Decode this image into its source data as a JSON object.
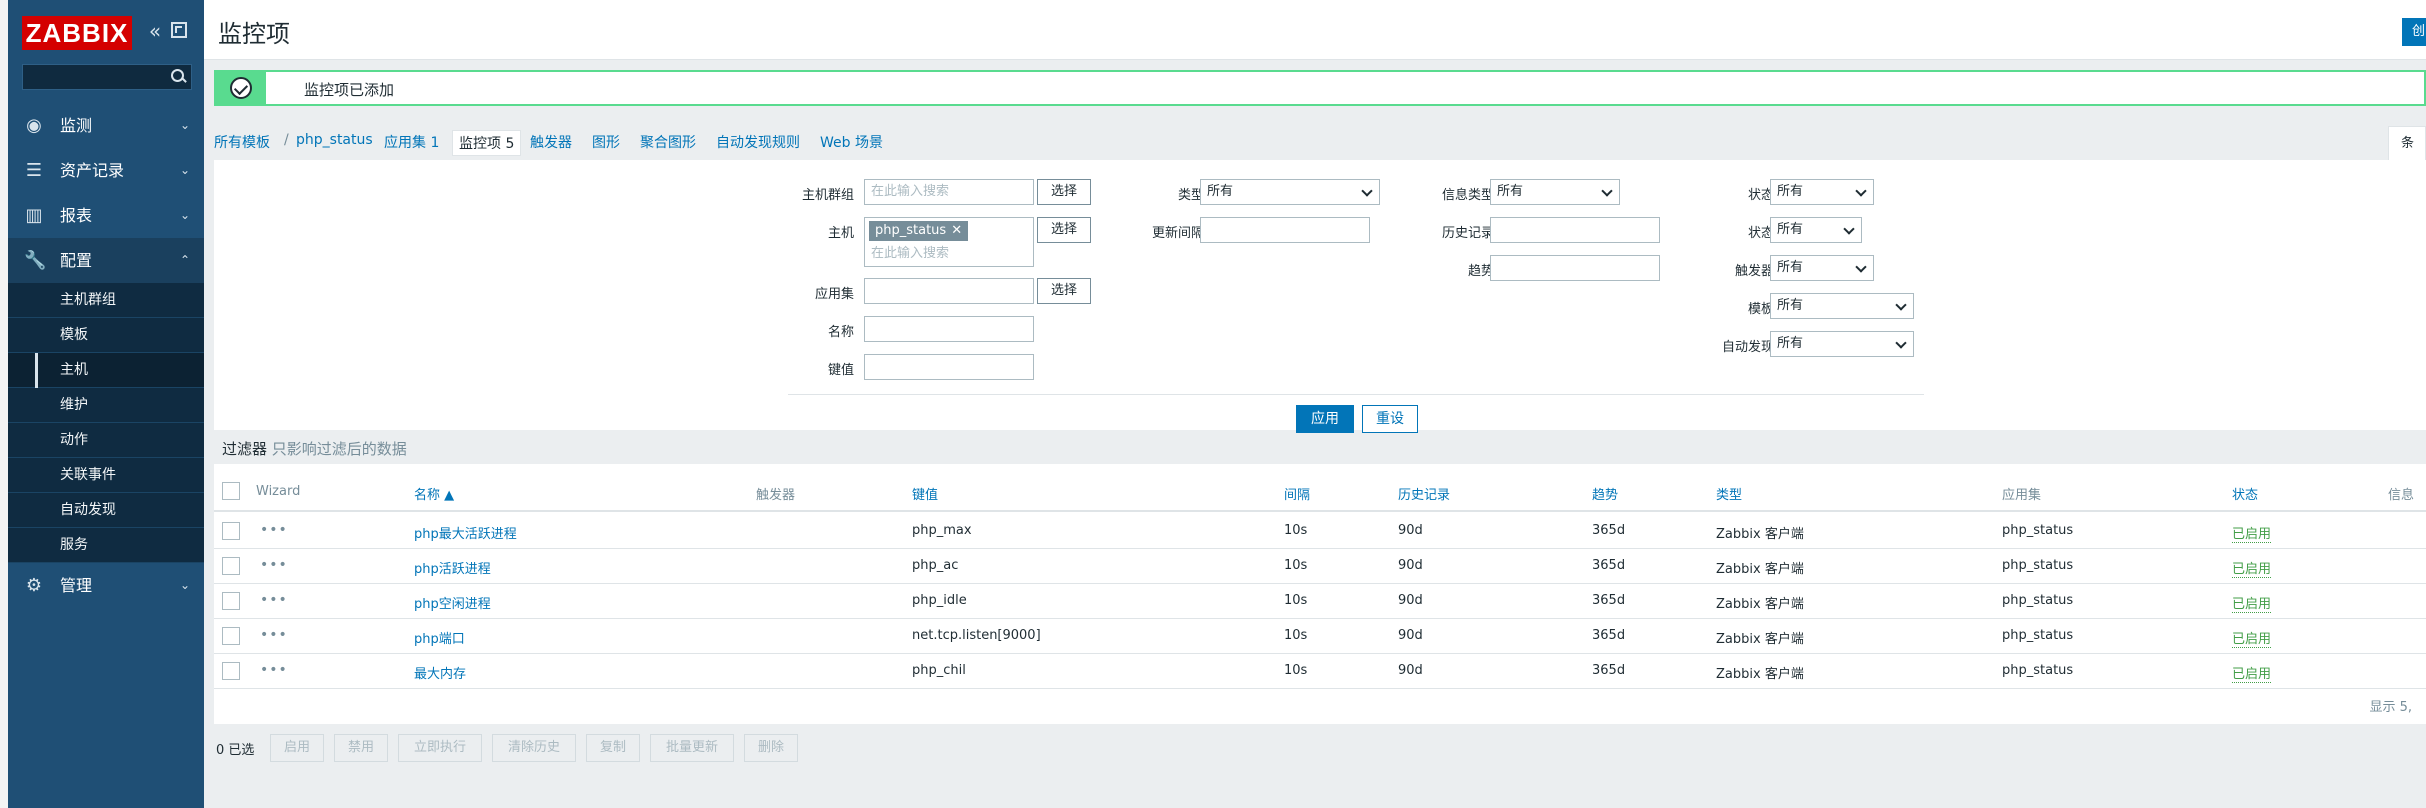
{
  "sidebar": {
    "logo": "ZABBIX",
    "menu": [
      {
        "label": "监测",
        "icon": "eye-icon"
      },
      {
        "label": "资产记录",
        "icon": "list-icon"
      },
      {
        "label": "报表",
        "icon": "bar-chart-icon"
      },
      {
        "label": "配置",
        "icon": "wrench-icon"
      },
      {
        "label": "管理",
        "icon": "gear-icon"
      }
    ],
    "submenu": [
      "主机群组",
      "模板",
      "主机",
      "维护",
      "动作",
      "关联事件",
      "自动发现",
      "服务"
    ]
  },
  "header": {
    "title": "监控项",
    "button_label": "创"
  },
  "message": {
    "text": "监控项已添加"
  },
  "breadcrumb": {
    "all_templates": "所有模板",
    "separator": "/",
    "template": "php_status",
    "tabs": [
      "应用集 1",
      "监控项 5",
      "触发器",
      "图形",
      "聚合图形",
      "自动发现规则",
      "Web 场景"
    ]
  },
  "filter_tab": "条件",
  "filter": {
    "host_group_label": "主机群组",
    "host_group_placeholder": "在此输入搜索",
    "host_label": "主机",
    "host_tag": "php_status",
    "host_placeholder": "在此输入搜索",
    "application_label": "应用集",
    "name_label": "名称",
    "key_label": "键值",
    "select_label": "选择",
    "type_label": "类型",
    "type_value": "所有",
    "interval_label": "更新间隔",
    "info_type_label": "信息类型",
    "info_type_value": "所有",
    "history_label": "历史记录",
    "trends_label": "趋势",
    "state_label": "状态",
    "state_value": "所有",
    "status_label": "状态",
    "status_value": "所有",
    "triggers_label": "触发器",
    "triggers_value": "所有",
    "template_label": "模板",
    "template_value": "所有",
    "discovery_label": "自动发现",
    "discovery_value": "所有",
    "apply_label": "应用",
    "reset_label": "重设"
  },
  "filter_note": {
    "title": "过滤器",
    "subtitle": "只影响过滤后的数据"
  },
  "table": {
    "headers": {
      "wizard": "Wizard",
      "name": "名称 ▲",
      "triggers": "触发器",
      "key": "键值",
      "interval": "间隔",
      "history": "历史记录",
      "trends": "趋势",
      "type": "类型",
      "applications": "应用集",
      "status": "状态",
      "info": "信息"
    },
    "rows": [
      {
        "name": "php最大活跃进程",
        "key": "php_max",
        "interval": "10s",
        "history": "90d",
        "trends": "365d",
        "type": "Zabbix 客户端",
        "app": "php_status",
        "status": "已启用"
      },
      {
        "name": "php活跃进程",
        "key": "php_ac",
        "interval": "10s",
        "history": "90d",
        "trends": "365d",
        "type": "Zabbix 客户端",
        "app": "php_status",
        "status": "已启用"
      },
      {
        "name": "php空闲进程",
        "key": "php_idle",
        "interval": "10s",
        "history": "90d",
        "trends": "365d",
        "type": "Zabbix 客户端",
        "app": "php_status",
        "status": "已启用"
      },
      {
        "name": "php端口",
        "key": "net.tcp.listen[9000]",
        "interval": "10s",
        "history": "90d",
        "trends": "365d",
        "type": "Zabbix 客户端",
        "app": "php_status",
        "status": "已启用"
      },
      {
        "name": "最大内存",
        "key": "php_chil",
        "interval": "10s",
        "history": "90d",
        "trends": "365d",
        "type": "Zabbix 客户端",
        "app": "php_status",
        "status": "已启用"
      }
    ],
    "footer": "显示 5,"
  },
  "actions": {
    "selected": "0 已选",
    "buttons": [
      "启用",
      "禁用",
      "立即执行",
      "清除历史",
      "复制",
      "批量更新",
      "删除"
    ]
  }
}
